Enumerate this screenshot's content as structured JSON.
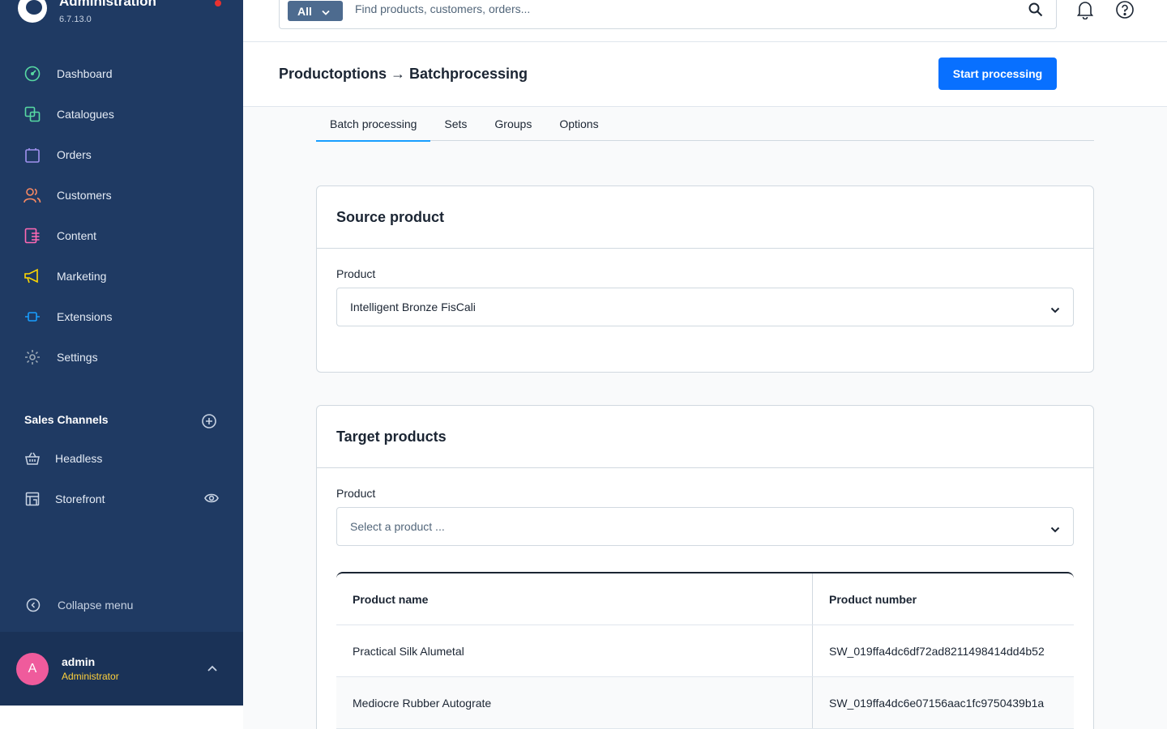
{
  "app": {
    "title": "Administration",
    "version": "6.7.13.0"
  },
  "sidebar": {
    "items": [
      {
        "label": "Dashboard",
        "icon": "gauge-icon",
        "color": "#57d9a3"
      },
      {
        "label": "Catalogues",
        "icon": "catalogue-icon",
        "color": "#57d9a3"
      },
      {
        "label": "Orders",
        "icon": "shopping-bag-icon",
        "color": "#a092f0"
      },
      {
        "label": "Customers",
        "icon": "users-icon",
        "color": "#f88962"
      },
      {
        "label": "Content",
        "icon": "content-icon",
        "color": "#ff68b4"
      },
      {
        "label": "Marketing",
        "icon": "megaphone-icon",
        "color": "#ffd700"
      },
      {
        "label": "Extensions",
        "icon": "plug-icon",
        "color": "#189eff"
      },
      {
        "label": "Settings",
        "icon": "gear-icon",
        "color": "#9aa8b5"
      }
    ],
    "sales_channels": {
      "title": "Sales Channels",
      "items": [
        {
          "label": "Headless",
          "icon": "basket-icon"
        },
        {
          "label": "Storefront",
          "icon": "storefront-icon"
        }
      ]
    },
    "collapse_label": "Collapse menu",
    "user": {
      "initial": "A",
      "name": "admin",
      "role": "Administrator"
    }
  },
  "topbar": {
    "search_type": "All",
    "search_placeholder": "Find products, customers, orders..."
  },
  "page": {
    "title": "Productoptions → Batchprocessing",
    "start_button": "Start processing"
  },
  "tabs": [
    {
      "label": "Batch processing",
      "active": true
    },
    {
      "label": "Sets",
      "active": false
    },
    {
      "label": "Groups",
      "active": false
    },
    {
      "label": "Options",
      "active": false
    }
  ],
  "source_card": {
    "title": "Source product",
    "field_label": "Product",
    "selected_value": "Intelligent Bronze FisCali"
  },
  "target_card": {
    "title": "Target products",
    "field_label": "Product",
    "placeholder": "Select a product ...",
    "columns": [
      "Product name",
      "Product number"
    ],
    "rows": [
      {
        "name": "Practical Silk Alumetal",
        "number": "SW_019ffa4dc6df72ad8211498414dd4b52"
      },
      {
        "name": "Mediocre Rubber Autograte",
        "number": "SW_019ffa4dc6e07156aac1fc9750439b1a"
      }
    ]
  },
  "colors": {
    "sidebar_bg": "#1f3a63",
    "primary_button": "#0870ff",
    "tab_active": "#189eff",
    "notification_dot": "#e8312f",
    "avatar": "#ef5b9c",
    "role": "#ffd13c"
  }
}
